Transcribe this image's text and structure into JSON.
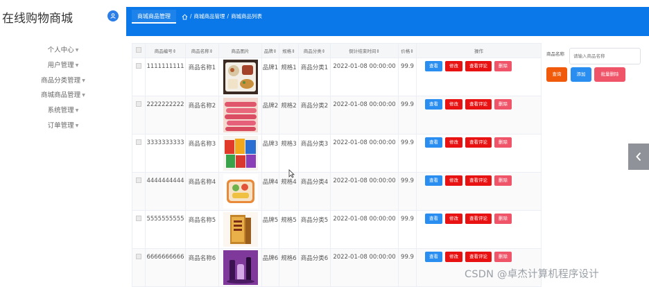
{
  "app": {
    "title": "在线购物商城"
  },
  "sidebar": {
    "items": [
      {
        "label": "个人中心"
      },
      {
        "label": "用户管理"
      },
      {
        "label": "商品分类管理"
      },
      {
        "label": "商城商品管理"
      },
      {
        "label": "系统管理"
      },
      {
        "label": "订单管理"
      }
    ]
  },
  "header": {
    "active_tab": "商城商品管理",
    "breadcrumb": [
      "商城商品管理",
      "商城商品列表"
    ],
    "accent_color": "#0a78e8"
  },
  "table": {
    "columns": [
      "商品编号",
      "商品名称",
      "商品图片",
      "品牌",
      "规格",
      "商品分类",
      "倒计结束时间",
      "价格",
      "操作"
    ],
    "sort_marker": "⇕",
    "rows": [
      {
        "id": "1111111111",
        "name": "商品名称1",
        "brand": "品牌1",
        "spec": "规格1",
        "category": "商品分类1",
        "end_time": "2022-01-08 00:00:00",
        "price": "99.9",
        "image": "bento-box"
      },
      {
        "id": "2222222222",
        "name": "商品名称2",
        "brand": "品牌2",
        "spec": "规格2",
        "category": "商品分类2",
        "end_time": "2022-01-08 00:00:00",
        "price": "99.9",
        "image": "sausages"
      },
      {
        "id": "3333333333",
        "name": "商品名称3",
        "brand": "品牌3",
        "spec": "规格3",
        "category": "商品分类3",
        "end_time": "2022-01-08 00:00:00",
        "price": "99.9",
        "image": "snack-bags"
      },
      {
        "id": "4444444444",
        "name": "商品名称4",
        "brand": "品牌4",
        "spec": "规格4",
        "category": "商品分类4",
        "end_time": "2022-01-08 00:00:00",
        "price": "99.9",
        "image": "lunch-box"
      },
      {
        "id": "5555555555",
        "name": "商品名称5",
        "brand": "品牌5",
        "spec": "规格5",
        "category": "商品分类5",
        "end_time": "2022-01-08 00:00:00",
        "price": "99.9",
        "image": "tea-box"
      },
      {
        "id": "6666666666",
        "name": "商品名称6",
        "brand": "品牌6",
        "spec": "规格6",
        "category": "商品分类6",
        "end_time": "2022-01-08 00:00:00",
        "price": "99.9",
        "image": "cosmetics"
      }
    ],
    "actions": {
      "view": "查看",
      "edit": "修改",
      "review": "查看评论",
      "delete": "删除"
    }
  },
  "search": {
    "label": "商品名称",
    "placeholder": "请输入商品名称",
    "query_button": "查询",
    "add_button": "添加",
    "batch_delete_button": "批量删除"
  },
  "watermark": "CSDN @卓杰计算机程序设计"
}
